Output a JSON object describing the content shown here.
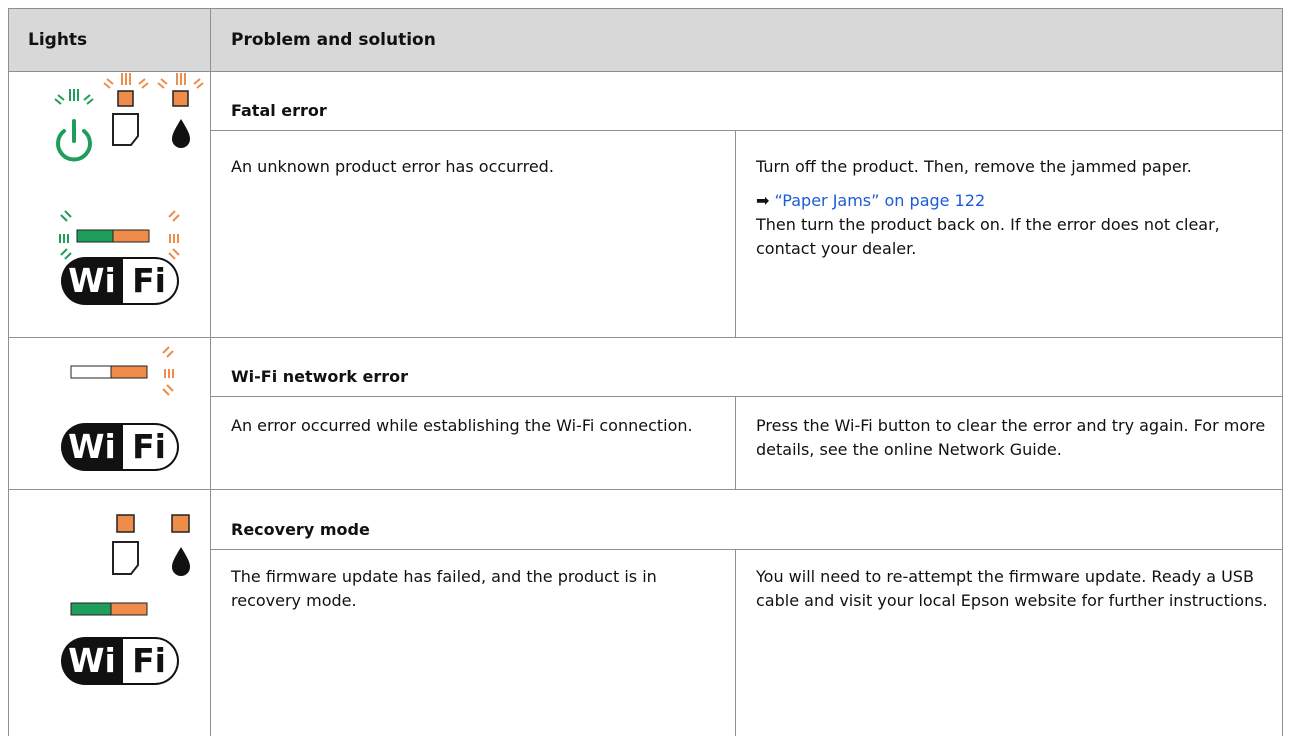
{
  "header": {
    "lights_label": "Lights",
    "problem_label": "Problem and solution"
  },
  "rows": [
    {
      "title": "Fatal error",
      "problem": "An unknown product error has occurred.",
      "solution_1": "Turn off the product. Then, remove the jammed paper.",
      "link_arrow": "➡",
      "link_text": "“Paper Jams” on page 122",
      "solution_2": "Then turn the product back on. If the error does not clear, contact your dealer.",
      "icons": [
        "power-icon-flashing-green",
        "paper-icon-flashing-orange",
        "ink-icon-flashing-orange",
        "wifi-bar-flashing-green-orange",
        "wifi-logo"
      ]
    },
    {
      "title": "Wi-Fi network error",
      "problem": "An error occurred while establishing the Wi-Fi connection.",
      "solution_1": "Press the Wi-Fi button to clear the error and try again. For more details, see the online Network Guide.",
      "icons": [
        "wifi-bar-flashing-orange",
        "wifi-logo"
      ]
    },
    {
      "title": "Recovery mode",
      "problem": "The firmware update has failed, and the product is in recovery mode.",
      "solution_1": "You will need to re-attempt the firmware update. Ready a USB cable and visit your local Epson website for further instructions.",
      "icons": [
        "paper-icon-orange",
        "ink-icon-orange",
        "wifi-bar-green-orange",
        "wifi-logo"
      ]
    }
  ],
  "logo_text": {
    "wi": "Wi",
    "fi": "Fi"
  },
  "colors": {
    "green": "#1e9e5a",
    "orange": "#f08c4a",
    "header_bg": "#d8d8d8",
    "link": "#1a5bd8"
  }
}
